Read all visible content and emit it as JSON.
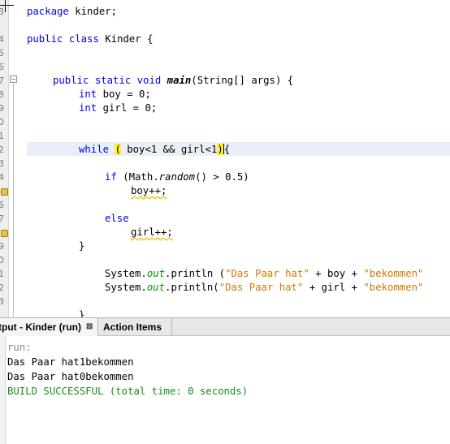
{
  "editor": {
    "line_numbers": [
      "3",
      "3",
      "4",
      "5",
      "6",
      "7",
      "8",
      "9",
      "0",
      "1",
      "2",
      "3",
      "4",
      "5",
      "6",
      "7",
      "8",
      "9",
      "0",
      "1",
      "2",
      "3",
      "4"
    ],
    "lines": {
      "l1": {
        "kw": "package",
        "rest": " kinder;"
      },
      "l3": {
        "kw1": "public",
        "kw2": "class",
        "rest": " Kinder {"
      },
      "l6": {
        "kw": "public static void",
        "name": "main",
        "rest": "(String[] args) {"
      },
      "l7": {
        "kw": "int",
        "rest": " boy = 0;"
      },
      "l8": {
        "kw": "int",
        "rest": " girl = 0;"
      },
      "l11": {
        "kw": "while",
        "open": "(",
        "cond": " boy<1 && girl<1",
        "close": ")",
        "tail": "{"
      },
      "l13": {
        "kw": "if",
        "pre": " (Math.",
        "call": "random",
        "post": "() > 0.5)"
      },
      "l14": {
        "text": "boy++;"
      },
      "l16": {
        "kw": "else"
      },
      "l17": {
        "text": "girl++;"
      },
      "l18": {
        "text": "}"
      },
      "l20": {
        "pre": "System.",
        "field": "out",
        "mid": ".println (",
        "s1": "\"Das Paar hat\"",
        "mid2": " + boy + ",
        "s2": "\"bekommen\""
      },
      "l21": {
        "pre": "System.",
        "field": "out",
        "mid": ".println(",
        "s1": "\"Das Paar hat\"",
        "mid2": " + girl + ",
        "s2": "\"bekommen\""
      },
      "l23": {
        "text": "}"
      }
    }
  },
  "tabs": {
    "output_label": "tput - Kinder (run)",
    "close_glyph": "⊠",
    "actions_label": "Action Items"
  },
  "output": {
    "lines": [
      "run:",
      "Das Paar hat1bekommen",
      "Das Paar hat0bekommen",
      "BUILD SUCCESSFUL (total time: 0 seconds)"
    ]
  },
  "colors": {
    "keyword": "#0000e6",
    "string": "#ce7b00",
    "field": "#009900",
    "success": "#1b8a1b",
    "brace_highlight": "#ffef28"
  }
}
